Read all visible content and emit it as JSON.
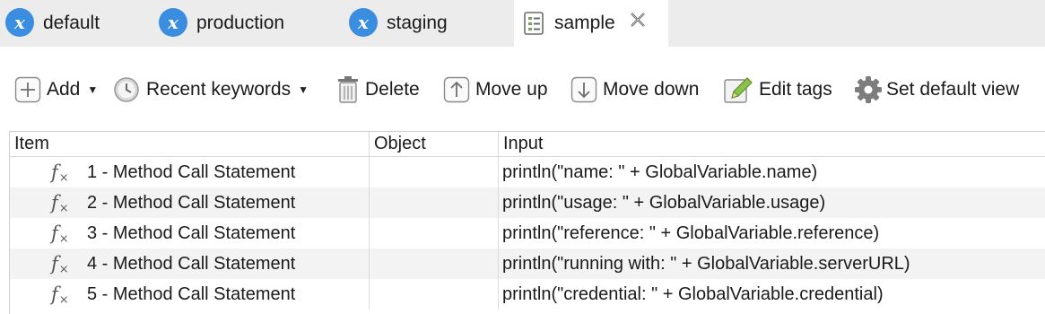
{
  "tabs": [
    {
      "label": "default",
      "icon": "profile-x-icon"
    },
    {
      "label": "production",
      "icon": "profile-x-icon"
    },
    {
      "label": "staging",
      "icon": "profile-x-icon"
    },
    {
      "label": "sample",
      "icon": "test-suite-icon",
      "active": true
    }
  ],
  "toolbar": {
    "add_label": "Add",
    "recent_label": "Recent keywords",
    "delete_label": "Delete",
    "move_up_label": "Move up",
    "move_down_label": "Move down",
    "edit_tags_label": "Edit tags",
    "set_default_view_label": "Set default view"
  },
  "table": {
    "columns": [
      "Item",
      "Object",
      "Input"
    ],
    "rows": [
      {
        "item": "1 - Method Call Statement",
        "object": "",
        "input": "println(\"name: \" + GlobalVariable.name)"
      },
      {
        "item": "2 - Method Call Statement",
        "object": "",
        "input": "println(\"usage: \" + GlobalVariable.usage)"
      },
      {
        "item": "3 - Method Call Statement",
        "object": "",
        "input": "println(\"reference: \" + GlobalVariable.reference)"
      },
      {
        "item": "4 - Method Call Statement",
        "object": "",
        "input": "println(\"running with: \" + GlobalVariable.serverURL)"
      },
      {
        "item": "5 - Method Call Statement",
        "object": "",
        "input": "println(\"credential: \" + GlobalVariable.credential)"
      }
    ]
  },
  "colors": {
    "tab_bar_bg": "#ececec",
    "profile_icon": "#3a8ddf",
    "row_stripe": "#f3f3f3"
  }
}
